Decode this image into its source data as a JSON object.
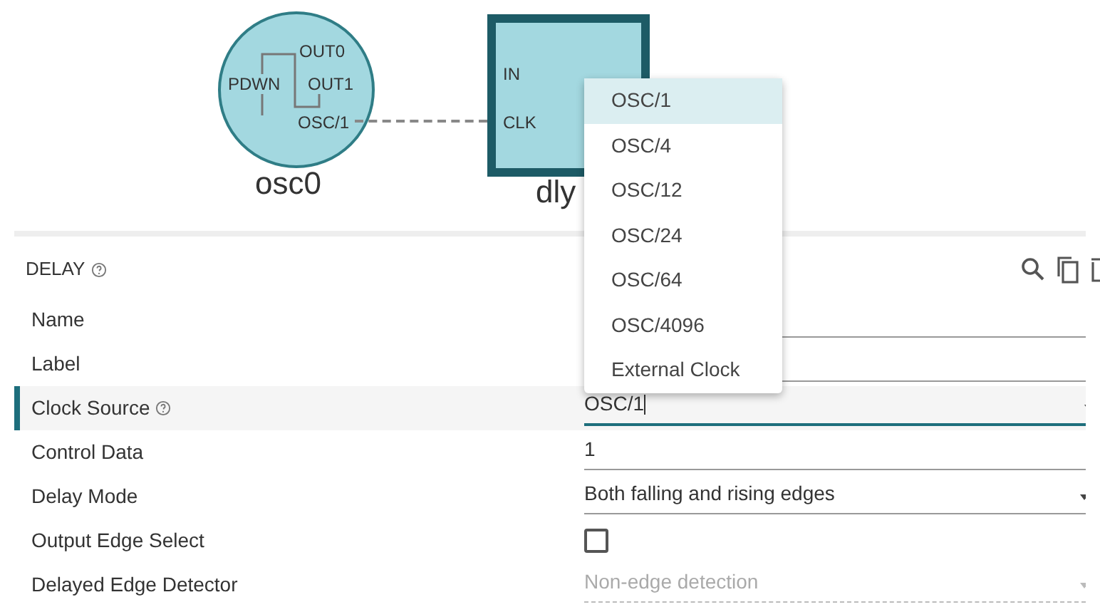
{
  "diagram": {
    "oscillator": {
      "label": "osc0",
      "pins": [
        "OUT0",
        "PDWN",
        "OUT1",
        "OSC/1"
      ]
    },
    "delay_block": {
      "label": "dly",
      "pins": [
        "IN",
        "CLK"
      ]
    }
  },
  "panel": {
    "title": "DELAY",
    "fields": [
      {
        "label": "Name",
        "kind": "text",
        "help": false,
        "focused": false
      },
      {
        "label": "Label",
        "kind": "text",
        "help": false,
        "focused": false
      },
      {
        "label": "Clock Source",
        "kind": "select",
        "value": "OSC/1",
        "help": true,
        "focused": true,
        "open": true
      },
      {
        "label": "Control Data",
        "kind": "text",
        "value": "1",
        "help": false,
        "focused": false
      },
      {
        "label": "Delay Mode",
        "kind": "select",
        "value": "Both falling and rising edges",
        "help": false,
        "focused": false,
        "open": false
      },
      {
        "label": "Output Edge Select",
        "kind": "checkbox",
        "checked": false,
        "help": false,
        "focused": false
      },
      {
        "label": "Delayed Edge Detector",
        "kind": "select",
        "value": "Non-edge detection",
        "help": false,
        "focused": false,
        "open": false,
        "disabled": true
      }
    ]
  },
  "dropdown": {
    "options": [
      {
        "label": "OSC/1",
        "selected": true
      },
      {
        "label": "OSC/4",
        "selected": false
      },
      {
        "label": "OSC/12",
        "selected": false
      },
      {
        "label": "OSC/24",
        "selected": false
      },
      {
        "label": "OSC/64",
        "selected": false
      },
      {
        "label": "OSC/4096",
        "selected": false
      },
      {
        "label": "External Clock",
        "selected": false
      }
    ]
  }
}
